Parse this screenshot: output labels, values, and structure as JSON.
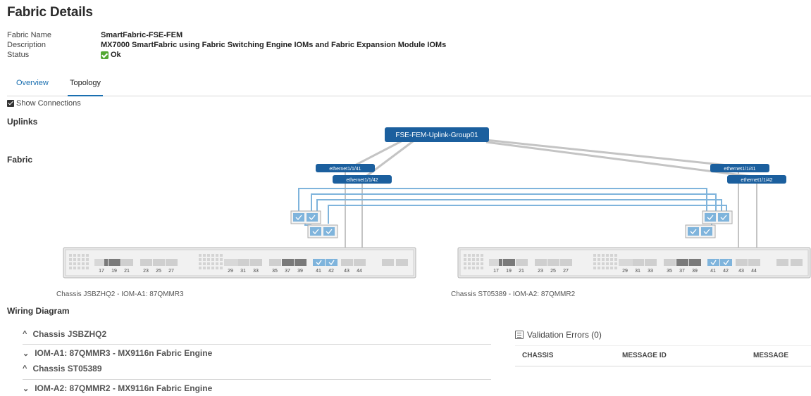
{
  "page": {
    "title": "Fabric Details"
  },
  "details": {
    "name_label": "Fabric Name",
    "name_value": "SmartFabric-FSE-FEM",
    "description_label": "Description",
    "description_value": "MX7000 SmartFabric using Fabric Switching Engine IOMs and Fabric Expansion Module IOMs",
    "status_label": "Status",
    "status_value": "Ok",
    "status_icon": "check-icon",
    "status_color": "#52a832"
  },
  "tabs": [
    {
      "label": "Overview",
      "active": false
    },
    {
      "label": "Topology",
      "active": true
    }
  ],
  "show_connections": {
    "label": "Show Connections",
    "checked": true
  },
  "sections": {
    "uplinks": "Uplinks",
    "fabric": "Fabric"
  },
  "topology": {
    "uplink_group": "FSE-FEM-Uplink-Group01",
    "left_ports": [
      "ethernet1/1/41",
      "ethernet1/1/42"
    ],
    "right_ports": [
      "ethernet1/1/41",
      "ethernet1/1/42"
    ],
    "switch_port_labels": [
      "17",
      "19",
      "21",
      "23",
      "25",
      "27",
      "29",
      "31",
      "33",
      "35",
      "37",
      "39",
      "41",
      "42",
      "43",
      "44"
    ],
    "left_chassis_label": "Chassis JSBZHQ2 - IOM-A1: 87QMMR3",
    "right_chassis_label": "Chassis ST05389 - IOM-A2: 87QMMR2",
    "accent_color": "#1b5f9e",
    "link_color": "#7fb4dc"
  },
  "wiring": {
    "title": "Wiring Diagram",
    "items": [
      {
        "label": "Chassis JSBZHQ2",
        "icon": "chevron-up-icon"
      },
      {
        "label": "IOM-A1: 87QMMR3 - MX9116n Fabric Engine",
        "icon": "chevron-down-icon"
      },
      {
        "label": "Chassis ST05389",
        "icon": "chevron-up-icon"
      },
      {
        "label": "IOM-A2: 87QMMR2 - MX9116n Fabric Engine",
        "icon": "chevron-down-icon"
      }
    ]
  },
  "validation": {
    "title": "Validation Errors (0)",
    "icon": "list-icon",
    "columns": [
      "CHASSIS",
      "MESSAGE ID",
      "MESSAGE"
    ]
  }
}
